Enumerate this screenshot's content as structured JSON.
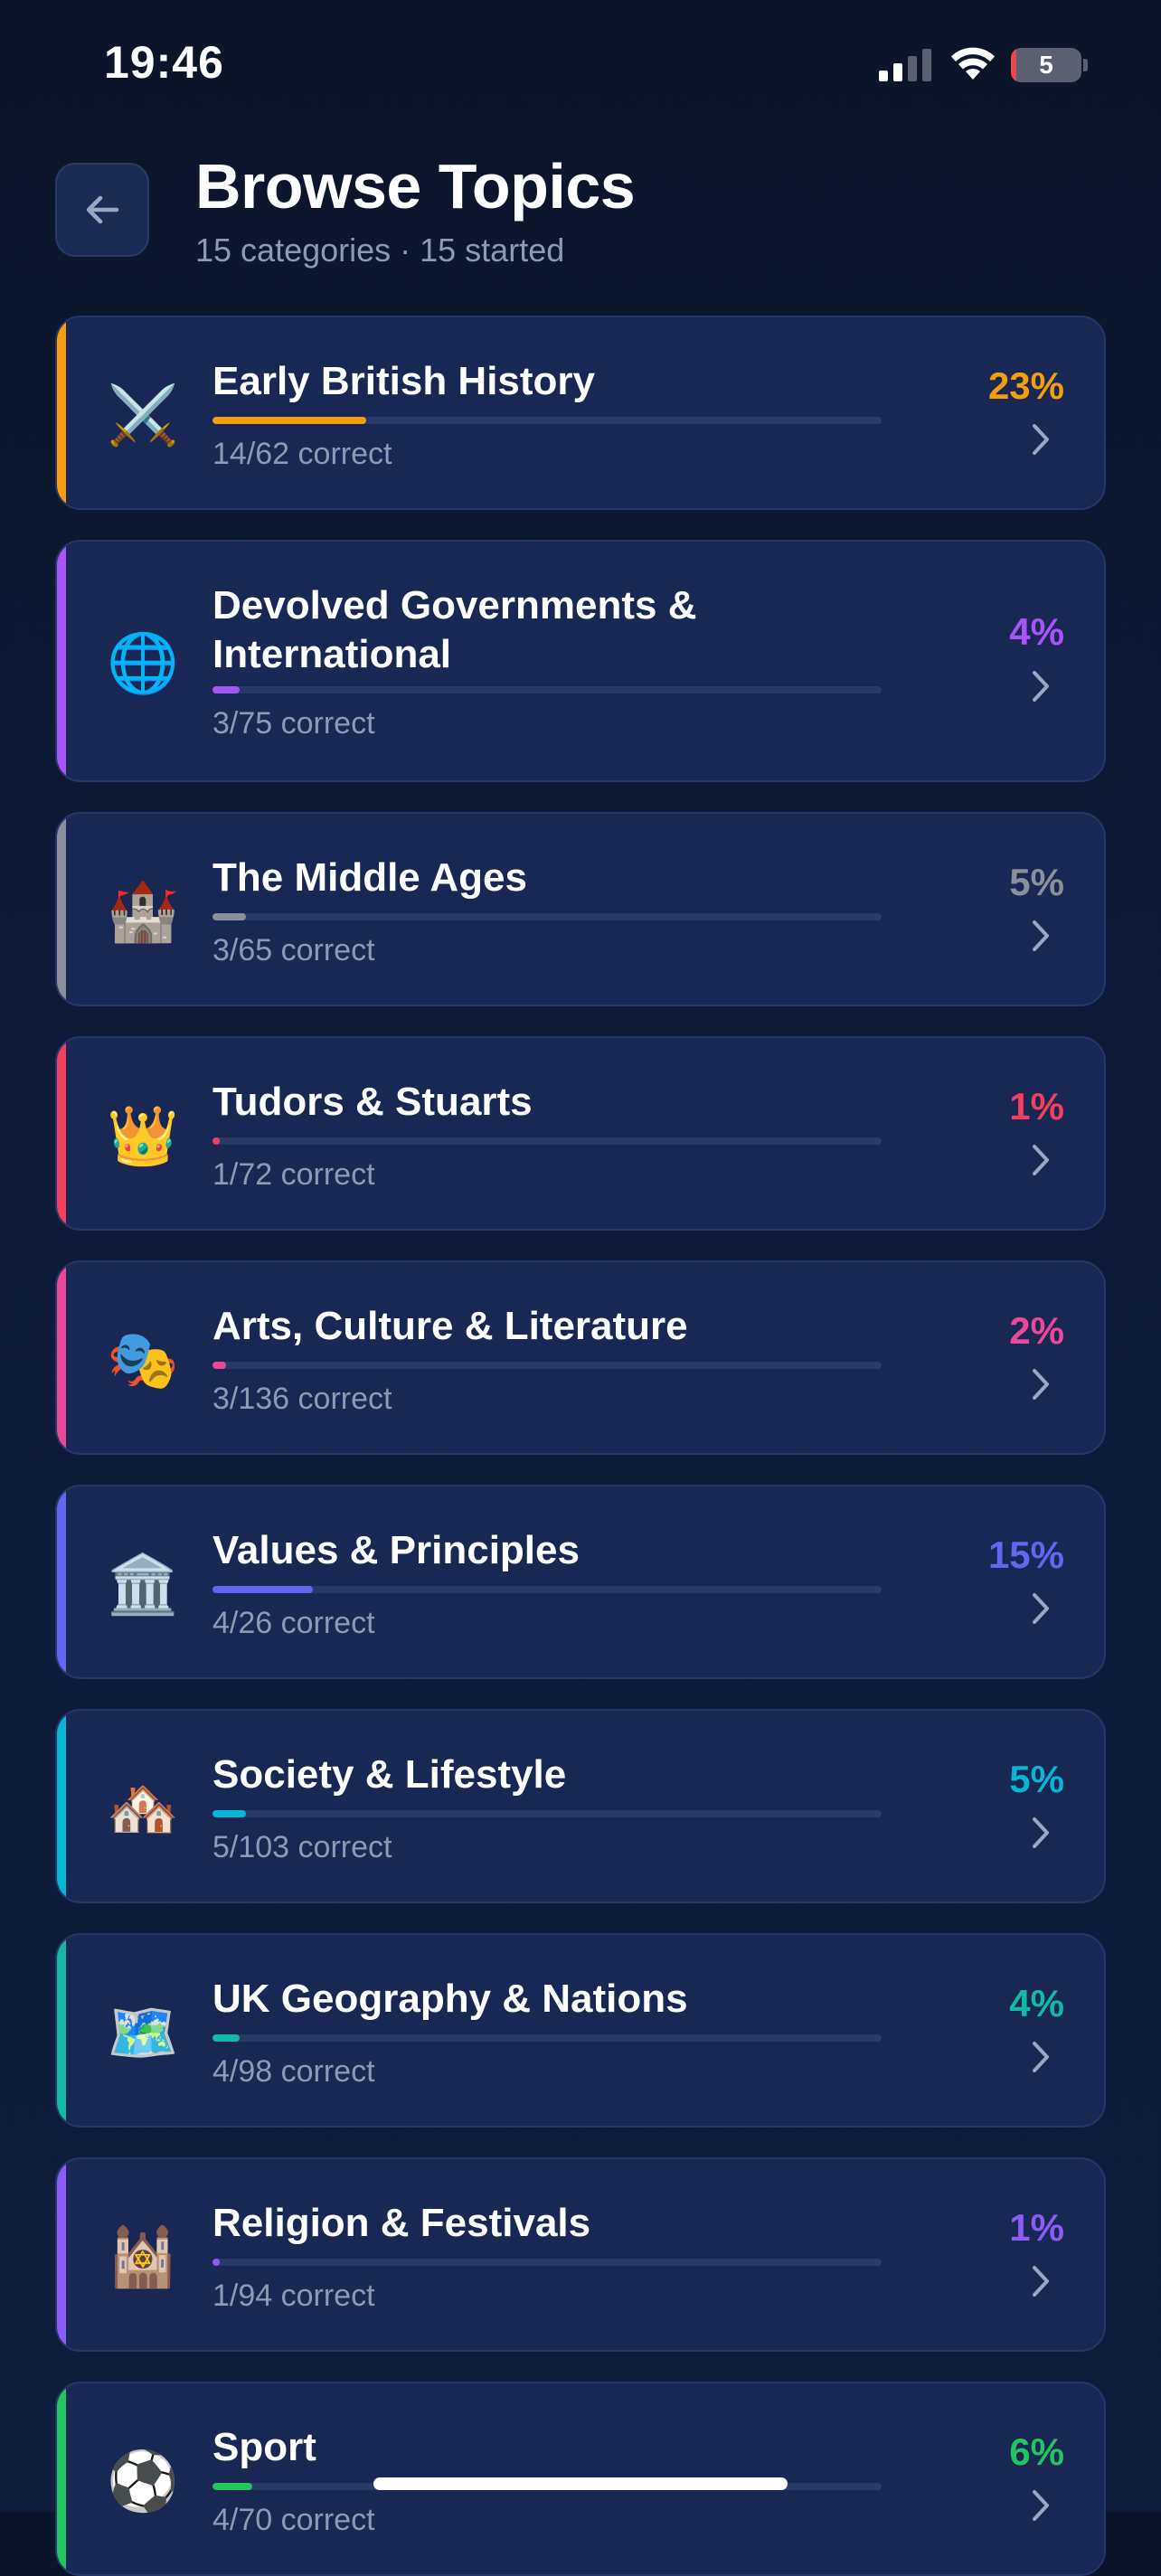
{
  "status_bar": {
    "time": "19:46",
    "battery_level": "5"
  },
  "header": {
    "title": "Browse Topics",
    "subtitle": "15 categories · 15 started",
    "back_icon": "arrow-left-icon"
  },
  "topics": [
    {
      "title": "Early British History",
      "correct": "14/62 correct",
      "percent": "23%",
      "progress": 0.23,
      "color": "#f59e0b",
      "icon": "⚔️",
      "icon_name": "crossed-swords-icon"
    },
    {
      "title": "Devolved Governments & International",
      "correct": "3/75 correct",
      "percent": "4%",
      "progress": 0.04,
      "color": "#a855f7",
      "icon": "🌐",
      "icon_name": "globe-icon"
    },
    {
      "title": "The Middle Ages",
      "correct": "3/65 correct",
      "percent": "5%",
      "progress": 0.05,
      "color": "#8a8f99",
      "icon": "🏰",
      "icon_name": "castle-icon"
    },
    {
      "title": "Tudors & Stuarts",
      "correct": "1/72 correct",
      "percent": "1%",
      "progress": 0.01,
      "color": "#f43f5e",
      "icon": "👑",
      "icon_name": "crown-icon"
    },
    {
      "title": "Arts, Culture & Literature",
      "correct": "3/136 correct",
      "percent": "2%",
      "progress": 0.02,
      "color": "#ec4899",
      "icon": "🎭",
      "icon_name": "theater-masks-icon"
    },
    {
      "title": "Values & Principles",
      "correct": "4/26 correct",
      "percent": "15%",
      "progress": 0.15,
      "color": "#6366f1",
      "icon": "🏛️",
      "icon_name": "classical-building-icon"
    },
    {
      "title": "Society & Lifestyle",
      "correct": "5/103 correct",
      "percent": "5%",
      "progress": 0.05,
      "color": "#06b6d4",
      "icon": "🏘️",
      "icon_name": "houses-icon"
    },
    {
      "title": "UK Geography & Nations",
      "correct": "4/98 correct",
      "percent": "4%",
      "progress": 0.04,
      "color": "#14b8a6",
      "icon": "🗺️",
      "icon_name": "map-icon"
    },
    {
      "title": "Religion & Festivals",
      "correct": "1/94 correct",
      "percent": "1%",
      "progress": 0.01,
      "color": "#8b5cf6",
      "icon": "🕍",
      "icon_name": "synagogue-icon"
    },
    {
      "title": "Sport",
      "correct": "4/70 correct",
      "percent": "6%",
      "progress": 0.06,
      "color": "#22c55e",
      "icon": "⚽",
      "icon_name": "soccer-ball-icon"
    }
  ]
}
